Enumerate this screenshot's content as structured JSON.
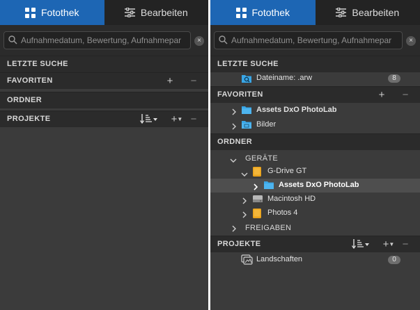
{
  "tabs": {
    "library": "Fotothek",
    "edit": "Bearbeiten"
  },
  "search": {
    "placeholder": "Aufnahmedatum, Bewertung, Aufnahmepar",
    "clear_icon": "×"
  },
  "sections": {
    "recent_search": "LETZTE SUCHE",
    "favorites": "FAVORITEN",
    "folders": "ORDNER",
    "projects": "PROJEKTE"
  },
  "controls": {
    "add": "+",
    "remove": "−"
  },
  "recent_search_items": [
    {
      "label": "Dateiname: .arw",
      "count": "8"
    }
  ],
  "favorites_items": [
    {
      "label": "Assets DxO PhotoLab"
    },
    {
      "label": "Bilder"
    }
  ],
  "folders_tree": {
    "devices_label": "GERÄTE",
    "drive_label": "G-Drive GT",
    "drive_child_label": "Assets DxO PhotoLab",
    "hd_label": "Macintosh HD",
    "photos_label": "Photos 4",
    "shares_label": "FREIGABEN"
  },
  "projects_items": [
    {
      "label": "Landschaften",
      "count": "0"
    }
  ],
  "colors": {
    "accent": "#1d66b4",
    "panel": "#3b3b3b",
    "header": "#2b2b2b",
    "selection": "#4e4e4e"
  }
}
